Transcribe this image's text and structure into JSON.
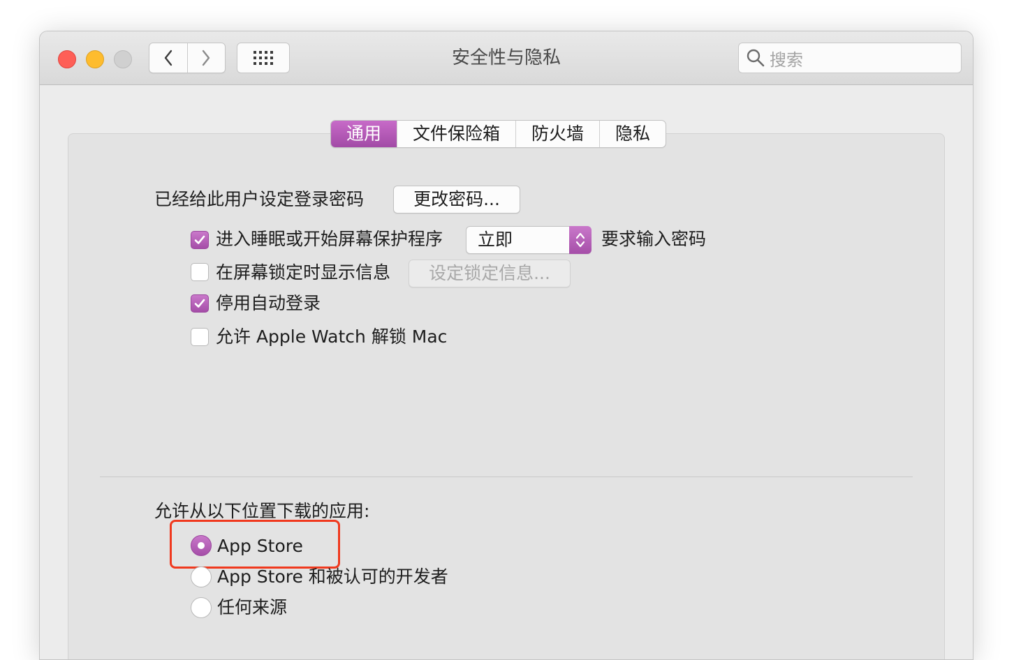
{
  "window": {
    "title": "安全性与隐私",
    "search_placeholder": "搜索"
  },
  "tabs": [
    {
      "label": "通用",
      "active": true
    },
    {
      "label": "文件保险箱",
      "active": false
    },
    {
      "label": "防火墙",
      "active": false
    },
    {
      "label": "隐私",
      "active": false
    }
  ],
  "general": {
    "password_label": "已经给此用户设定登录密码",
    "change_password_button": "更改密码...",
    "require_password": {
      "checked": true,
      "label": "进入睡眠或开始屏幕保护程序",
      "select_value": "立即",
      "suffix": "要求输入密码"
    },
    "show_message": {
      "checked": false,
      "label": "在屏幕锁定时显示信息",
      "button": "设定锁定信息..."
    },
    "disable_auto_login": {
      "checked": true,
      "label": "停用自动登录"
    },
    "apple_watch_unlock": {
      "checked": false,
      "label": "允许 Apple Watch 解锁 Mac"
    }
  },
  "download": {
    "label": "允许从以下位置下载的应用:",
    "options": [
      {
        "label": "App Store",
        "selected": true
      },
      {
        "label": "App Store 和被认可的开发者",
        "selected": false
      },
      {
        "label": "任何来源",
        "selected": false
      }
    ]
  },
  "colors": {
    "accent": "#b35bb6",
    "highlight_box": "#f0391e"
  }
}
